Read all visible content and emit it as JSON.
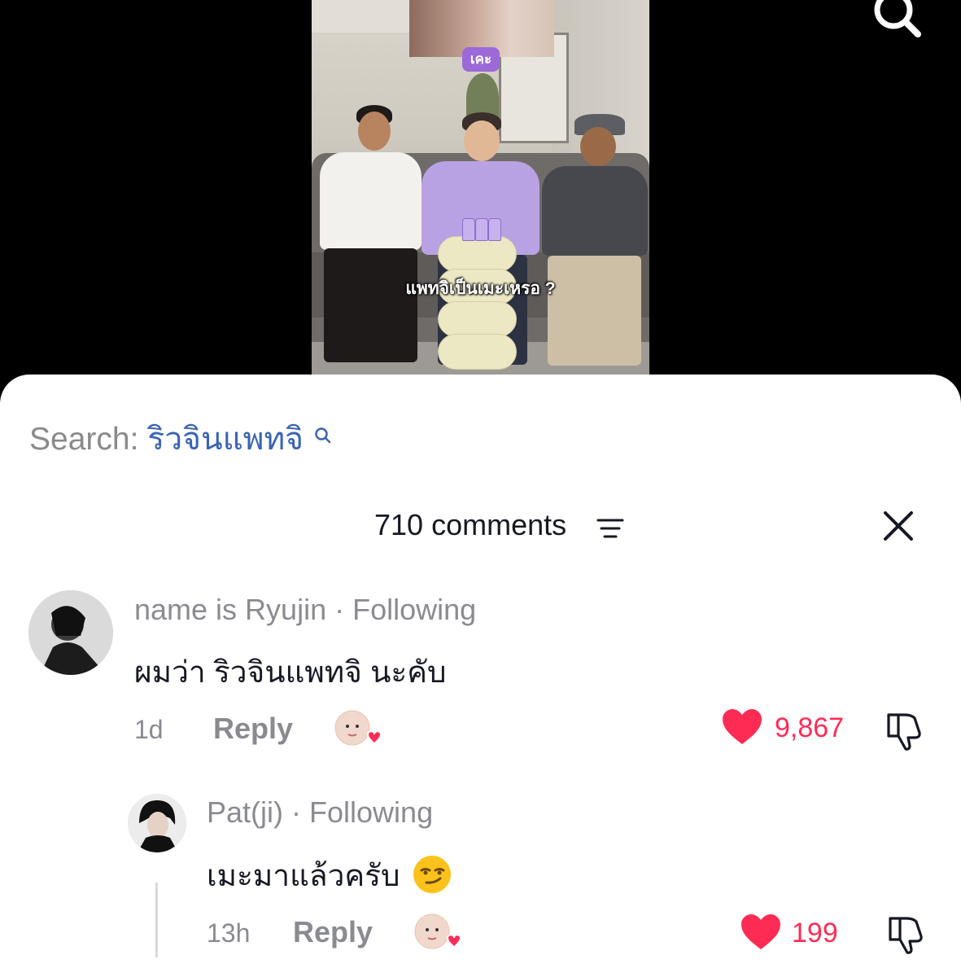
{
  "video": {
    "caption_tag": "เคะ",
    "caption": "แพทจิเป็นเมะเหรอ ?"
  },
  "search": {
    "label": "Search:",
    "term": "ริวจินแพทจิ"
  },
  "comments_header": {
    "count_label": "710 comments"
  },
  "comments": [
    {
      "username": "name is Ryujin",
      "relation": "· Following",
      "text": "ผมว่า ริวจินแพทจิ นะคับ",
      "time": "1d",
      "reply_label": "Reply",
      "likes": "9,867"
    },
    {
      "username": "Pat(ji)",
      "relation": "· Following",
      "text": "เมะมาแล้วครับ",
      "time": "13h",
      "reply_label": "Reply",
      "likes": "199"
    }
  ],
  "colors": {
    "like_red": "#fe2c55",
    "search_blue": "#3a63b3",
    "meta_gray": "#8a8b91",
    "text_dark": "#161823"
  },
  "icons": [
    "search-icon",
    "sort-icon",
    "close-icon",
    "heart-icon",
    "dislike-icon",
    "creator-liked-icon",
    "smirk-emoji-icon"
  ]
}
